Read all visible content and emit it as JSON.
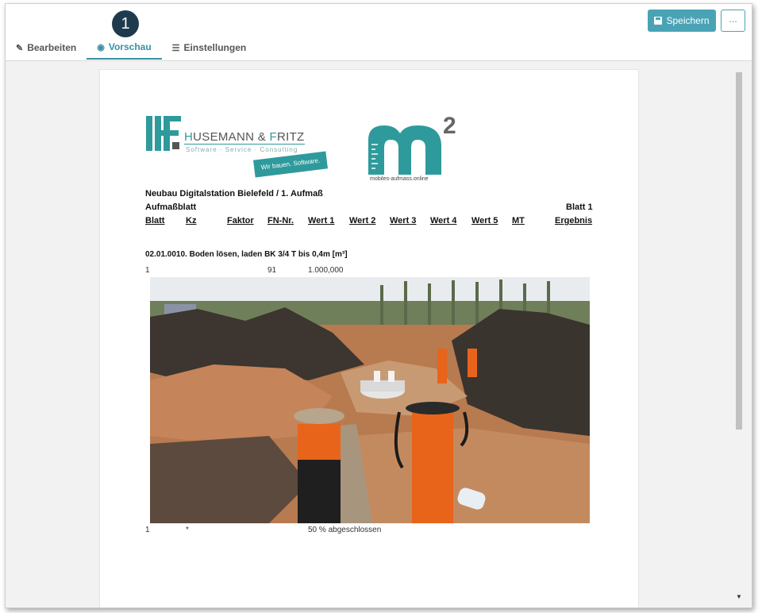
{
  "header": {
    "step_number": "1",
    "save_label": "Speichern",
    "more_label": "..."
  },
  "tabs": [
    {
      "label": "Bearbeiten",
      "icon": "edit-icon"
    },
    {
      "label": "Vorschau",
      "icon": "eye-icon"
    },
    {
      "label": "Einstellungen",
      "icon": "sliders-icon"
    }
  ],
  "logos": {
    "hf_name_first": "H",
    "hf_name_rest": "USEMANN & ",
    "hf_name_f": "F",
    "hf_name_end": "RITZ",
    "hf_sub": "Software · Service · Consulting",
    "hf_tag": "Wir bauen. Software.",
    "m2_sup": "2",
    "m2_url": "mobiles-aufmass.online"
  },
  "document": {
    "project_title": "Neubau Digitalstation Bielefeld / 1. Aufmaß",
    "sheet_type": "Aufmaßblatt",
    "sheet_number": "Blatt 1",
    "columns": [
      "Blatt",
      "Kz",
      "Faktor",
      "FN-Nr.",
      "Wert 1",
      "Wert 2",
      "Wert 3",
      "Wert 4",
      "Wert 5",
      "MT",
      "Ergebnis"
    ],
    "position_title": "02.01.0010. Boden lösen, laden BK 3/4 T bis 0,4m [m³]",
    "row1": {
      "blatt": "1",
      "fn": "91",
      "wert1": "1.000,000"
    },
    "row2": {
      "blatt": "1",
      "kz": "*",
      "wert1": "50 % abgeschlossen"
    }
  },
  "colors": {
    "accent": "#4aa3b5",
    "brand_teal": "#2f9a9c",
    "badge": "#1f3a4d"
  }
}
